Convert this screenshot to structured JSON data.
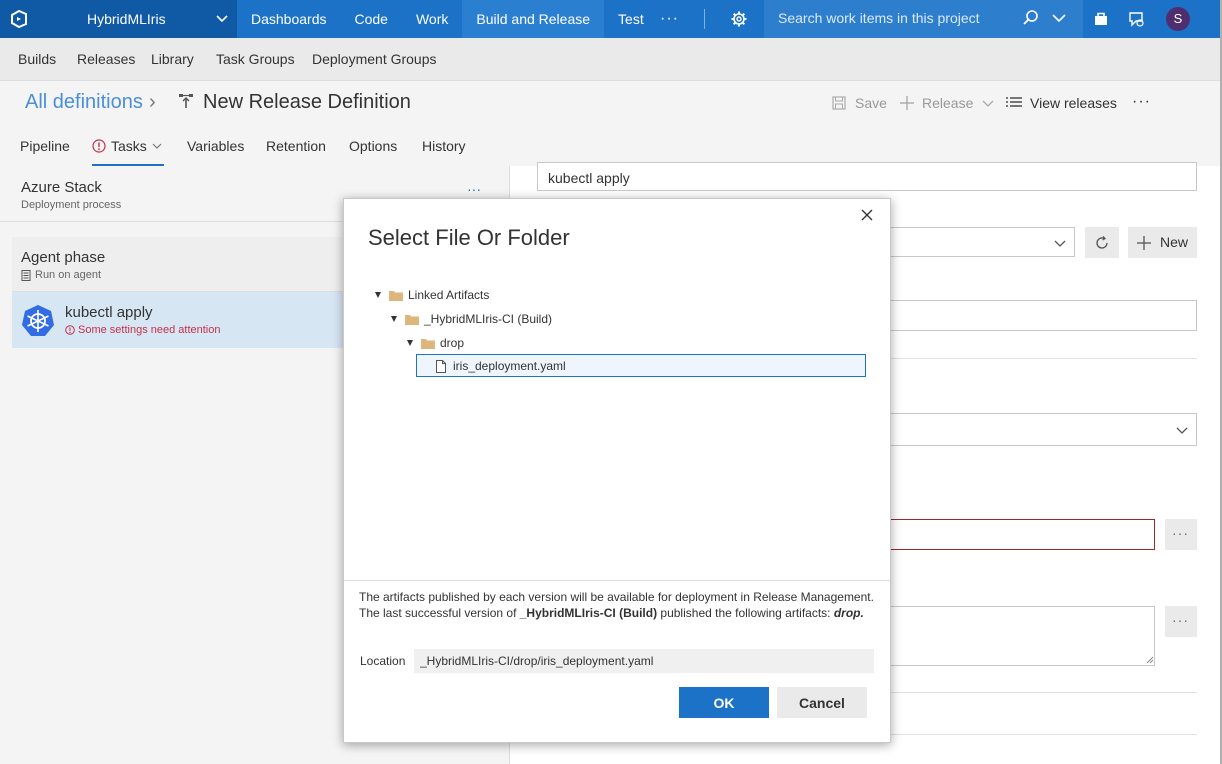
{
  "header": {
    "project": "HybridMLIris",
    "nav": [
      "Dashboards",
      "Code",
      "Work",
      "Build and Release",
      "Test"
    ],
    "active_nav": "Build and Release",
    "more": "···",
    "search_placeholder": "Search work items in this project",
    "avatar": "S"
  },
  "hub": {
    "items": [
      "Builds",
      "Releases",
      "Library",
      "Task Groups",
      "Deployment Groups"
    ]
  },
  "title_row": {
    "breadcrumb": "All definitions",
    "sep": "›",
    "title": "New Release Definition",
    "save": "Save",
    "release": "Release",
    "view_releases": "View releases",
    "more": "···"
  },
  "tabs": [
    "Pipeline",
    "Tasks",
    "Variables",
    "Retention",
    "Options",
    "History"
  ],
  "active_tab": "Tasks",
  "left": {
    "process_title": "Azure Stack",
    "process_sub": "Deployment process",
    "process_more": "···",
    "phase_title": "Agent phase",
    "phase_sub": "Run on agent",
    "task_title": "kubectl apply",
    "task_warning": "Some settings need attention"
  },
  "right": {
    "display_name": "kubectl apply",
    "new_label": "New",
    "dots": "···"
  },
  "dialog": {
    "title": "Select File Or Folder",
    "tree": {
      "root": "Linked Artifacts",
      "artifact": "_HybridMLIris-CI (Build)",
      "folder": "drop",
      "file": "iris_deployment.yaml"
    },
    "info_line1": "The artifacts published by each version will be available for deployment in Release Management.",
    "info_line2_prefix": "The last successful version of ",
    "info_line2_bold": "_HybridMLIris-CI (Build)",
    "info_line2_mid": " published the following artifacts: ",
    "info_line2_italic": "drop.",
    "location_label": "Location",
    "location_value": "_HybridMLIris-CI/drop/iris_deployment.yaml",
    "ok": "OK",
    "cancel": "Cancel"
  },
  "colors": {
    "topbar": "#1b72c6",
    "topbar_dark": "#0f59a5",
    "accent": "#1b72c6",
    "error": "#c4314b",
    "folder": "#dcb67a"
  }
}
